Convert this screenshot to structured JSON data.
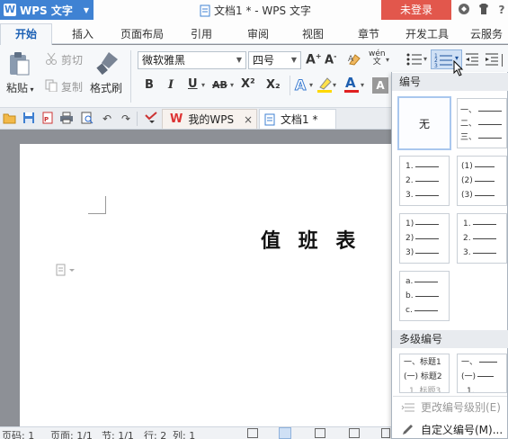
{
  "app": {
    "name": "WPS 文字",
    "logo": "W"
  },
  "window": {
    "doc_title": "文档1 * - WPS 文字",
    "login_label": "未登录"
  },
  "tabs": [
    "开始",
    "插入",
    "页面布局",
    "引用",
    "审阅",
    "视图",
    "章节",
    "开发工具",
    "云服务"
  ],
  "toolbar": {
    "paste": "粘贴",
    "cut": "剪切",
    "copy": "复制",
    "format_painter": "格式刷",
    "font_name": "微软雅黑",
    "font_size": "四号",
    "bold": "B",
    "italic": "I",
    "underline": "U",
    "strike": "AB",
    "superscript": "X²",
    "subscript": "X₂",
    "wen_label": "wén\n文"
  },
  "quickbar": {
    "tab_mywps": "我的WPS",
    "tab_doc": "文档1 *",
    "close": "×"
  },
  "document": {
    "heading": "值 班 表"
  },
  "statusbar": {
    "page_code": "页码: 1",
    "page": "页面: 1/1",
    "section": "节: 1/1",
    "row": "行: 2",
    "col": "列: 1"
  },
  "dropdown": {
    "numbering_header": "编号",
    "multilevel_header": "多级编号",
    "none_label": "无",
    "tiles": {
      "chinese_enum": [
        "一、",
        "二、",
        "三、"
      ],
      "decimal": [
        "1.",
        "2.",
        "3."
      ],
      "paren_decimal": [
        "(1)",
        "(2)",
        "(3)"
      ],
      "rparen_decimal": [
        "1)",
        "2)",
        "3)"
      ],
      "decimal_alt": [
        "1.",
        "2.",
        "3."
      ],
      "lower_alpha": [
        "a.",
        "b.",
        "c."
      ]
    },
    "multilevel_tiles": {
      "left": [
        "一、标题1",
        "(一) 标题2",
        "1. 标题3"
      ],
      "right": [
        "一、",
        "(一)",
        "1."
      ]
    },
    "change_level": "更改编号级别(E)",
    "custom": "自定义编号(M)..."
  },
  "colors": {
    "brand": "#3f82d3",
    "login": "#e2574c",
    "accent_tab": "#1a5fb4"
  }
}
